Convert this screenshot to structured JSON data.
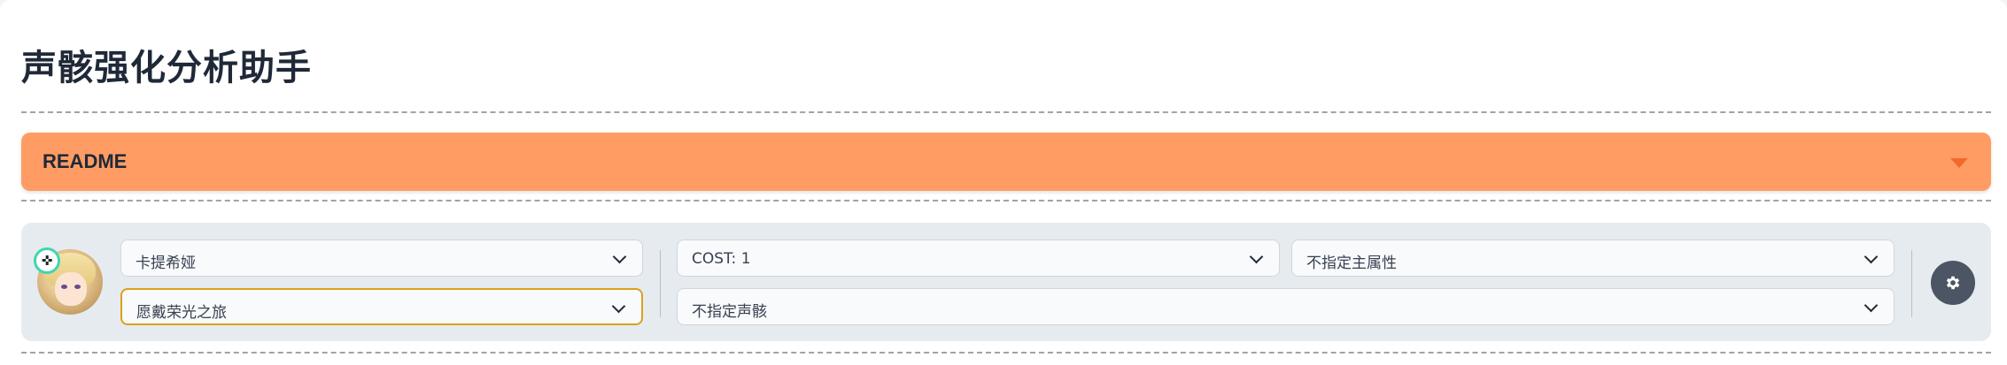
{
  "app": {
    "title": "声骸强化分析助手"
  },
  "readme": {
    "label": "README",
    "caret_icon": "caret-down-icon",
    "background": "#ff9c64",
    "caret_color": "#f26a2a"
  },
  "controls": {
    "avatar_icon": "character-avatar",
    "element_icon": "aero-element-icon",
    "element_glyph": "✜",
    "character_select": {
      "value": "卡提希娅"
    },
    "set_select": {
      "value": "愿戴荣光之旅"
    },
    "cost_select": {
      "value": "COST: 1"
    },
    "main_stat_select": {
      "value": "不指定主属性"
    },
    "echo_select": {
      "value": "不指定声骸"
    },
    "settings_icon": "gear-icon"
  },
  "colors": {
    "panel": "#e6ebf0",
    "active_border": "#d9a21a",
    "settings_button": "#4b5563"
  }
}
